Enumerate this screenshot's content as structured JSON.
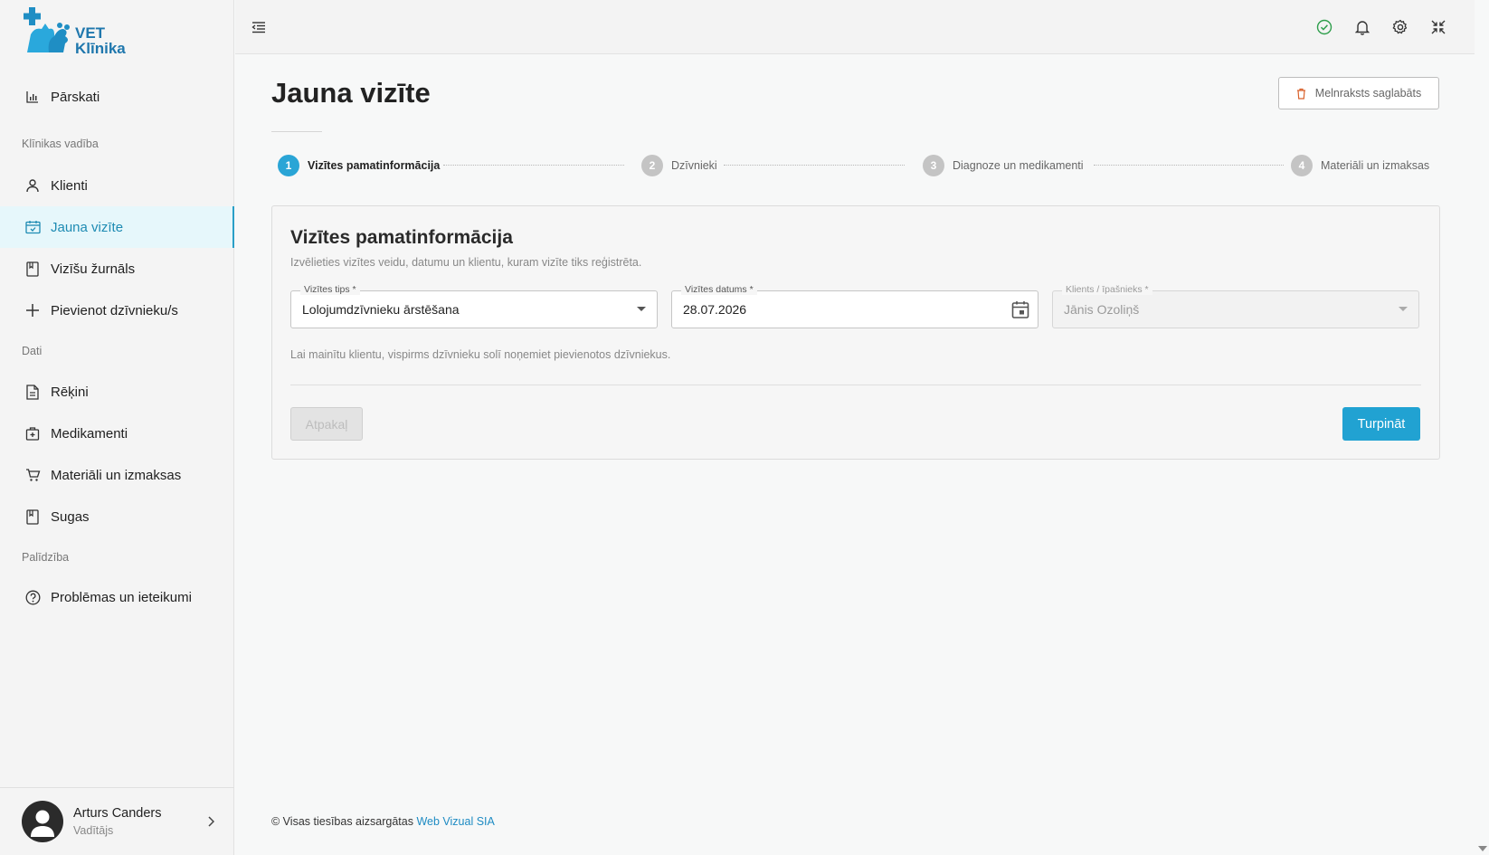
{
  "app": {
    "logo_line1": "VET",
    "logo_line2": "Klīnika",
    "brand_color": "#1f77ad",
    "accent_color": "#21a2d2"
  },
  "sidebar": {
    "top_item": {
      "label": "Pārskati",
      "icon": "bar-chart-icon"
    },
    "sections": [
      {
        "title": "Klīnikas vadība"
      },
      {
        "title": "Dati"
      },
      {
        "title": "Palīdzība"
      }
    ],
    "items": [
      {
        "label": "Klienti",
        "icon": "user-icon"
      },
      {
        "label": "Jauna vizīte",
        "icon": "calendar-check-icon",
        "active": true
      },
      {
        "label": "Vizīšu žurnāls",
        "icon": "bookmark-icon"
      },
      {
        "label": "Pievienot dzīvnieku/s",
        "icon": "plus-icon"
      },
      {
        "label": "Rēķini",
        "icon": "document-icon"
      },
      {
        "label": "Medikamenti",
        "icon": "medical-bag-icon"
      },
      {
        "label": "Materiāli un izmaksas",
        "icon": "cart-icon"
      },
      {
        "label": "Sugas",
        "icon": "bookmark-icon"
      },
      {
        "label": "Problēmas un ieteikumi",
        "icon": "help-circle-icon"
      }
    ],
    "user": {
      "name": "Arturs Canders",
      "role": "Vadītājs"
    }
  },
  "topbar": {
    "icons": [
      "menu-collapse-icon",
      "check-circle-icon",
      "bell-icon",
      "gear-icon",
      "fullscreen-exit-icon"
    ]
  },
  "main": {
    "title": "Jauna vizīte",
    "draft_button": "Melnraksts saglabāts",
    "steps": [
      {
        "num": "1",
        "label": "Vizītes pamatinformācija",
        "active": true
      },
      {
        "num": "2",
        "label": "Dzīvnieki"
      },
      {
        "num": "3",
        "label": "Diagnoze un medikamenti"
      },
      {
        "num": "4",
        "label": "Materiāli un izmaksas"
      }
    ],
    "card": {
      "title": "Vizītes pamatinformācija",
      "subtitle": "Izvēlieties vizītes veidu, datumu un klientu, kuram vizīte tiks reģistrēta.",
      "fields": {
        "visit_type": {
          "label": "Vizītes tips *",
          "value": "Lolojumdzīvnieku ārstēšana"
        },
        "visit_date": {
          "label": "Vizītes datums *",
          "value": "28.07.2026"
        },
        "client": {
          "label": "Klients / īpašnieks *",
          "value": "Jānis Ozoliņš",
          "disabled": true
        }
      },
      "hint": "Lai mainītu klientu, vispirms dzīvnieku solī noņemiet pievienotos dzīvniekus.",
      "back_button": "Atpakaļ",
      "next_button": "Turpināt"
    }
  },
  "footer": {
    "text": "© Visas tiesības aizsargātas",
    "link": "Web Vizual SIA"
  }
}
